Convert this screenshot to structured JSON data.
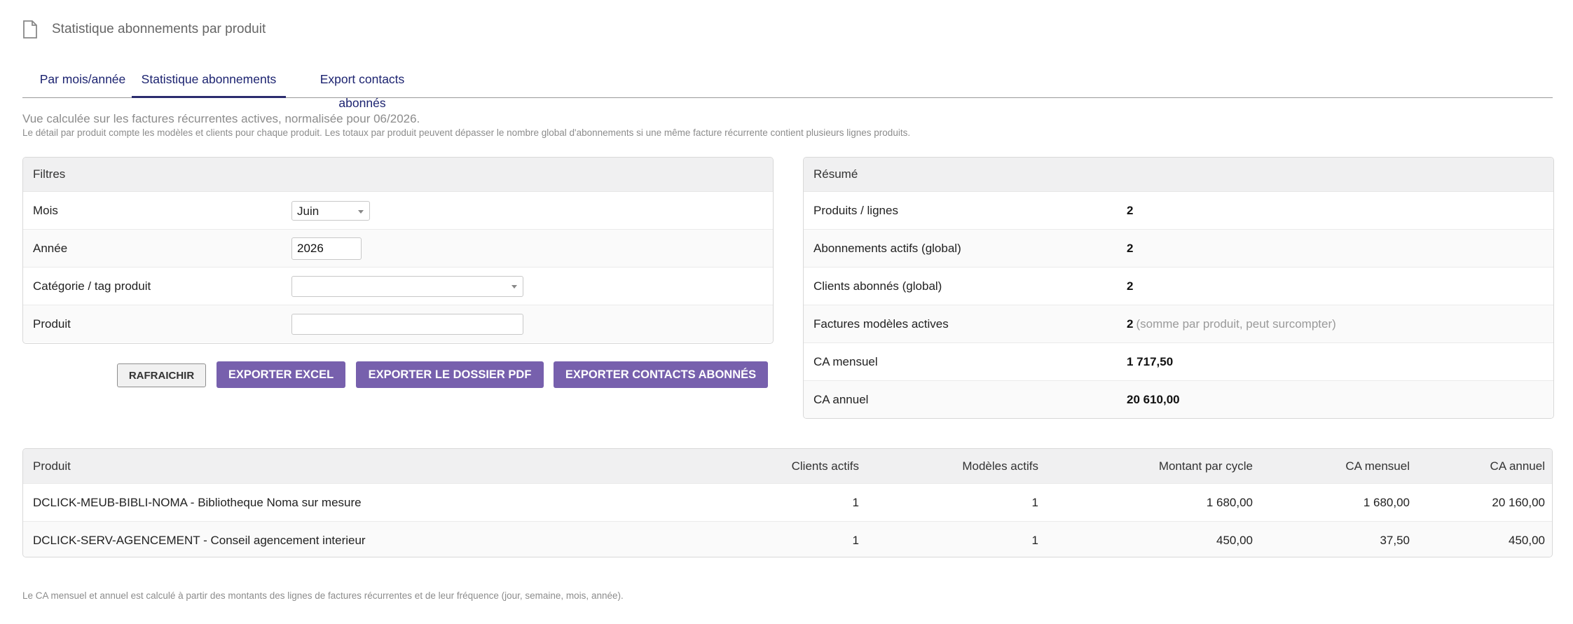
{
  "page": {
    "title": "Statistique abonnements par produit",
    "icon": "document-icon"
  },
  "tabs": [
    {
      "label": "Par mois/année",
      "active": false
    },
    {
      "label": "Statistique abonnements",
      "active": true
    },
    {
      "label": "Export contacts abonnés",
      "active": false
    }
  ],
  "info": {
    "line1": "Vue calculée sur les factures récurrentes actives, normalisée pour 06/2026.",
    "line2": "Le détail par produit compte les modèles et clients pour chaque produit. Les totaux par produit peuvent dépasser le nombre global d'abonnements si une même facture récurrente contient plusieurs lignes produits."
  },
  "filters": {
    "title": "Filtres",
    "month": {
      "label": "Mois",
      "value": "Juin"
    },
    "year": {
      "label": "Année",
      "value": "2026"
    },
    "category": {
      "label": "Catégorie / tag produit",
      "value": ""
    },
    "product": {
      "label": "Produit",
      "value": "",
      "placeholder": ""
    }
  },
  "buttons": {
    "refresh": "RAFRAICHIR",
    "export_excel": "EXPORTER EXCEL",
    "export_pdf": "EXPORTER LE DOSSIER PDF",
    "export_contacts": "EXPORTER CONTACTS ABONNÉS"
  },
  "summary": {
    "title": "Résumé",
    "rows": [
      {
        "label": "Produits / lignes",
        "value": "2",
        "note": ""
      },
      {
        "label": "Abonnements actifs (global)",
        "value": "2",
        "note": ""
      },
      {
        "label": "Clients abonnés (global)",
        "value": "2",
        "note": ""
      },
      {
        "label": "Factures modèles actives",
        "value": "2",
        "note": "(somme par produit, peut surcompter)"
      },
      {
        "label": "CA mensuel",
        "value": "1 717,50",
        "note": ""
      },
      {
        "label": "CA annuel",
        "value": "20 610,00",
        "note": ""
      }
    ]
  },
  "table": {
    "columns": [
      "Produit",
      "Clients actifs",
      "Modèles actifs",
      "Montant par cycle",
      "CA mensuel",
      "CA annuel"
    ],
    "rows": [
      [
        "DCLICK-MEUB-BIBLI-NOMA - Bibliotheque Noma sur mesure",
        "1",
        "1",
        "1 680,00",
        "1 680,00",
        "20 160,00"
      ],
      [
        "DCLICK-SERV-AGENCEMENT - Conseil agencement interieur",
        "1",
        "1",
        "450,00",
        "37,50",
        "450,00"
      ]
    ]
  },
  "footnote": "Le CA mensuel et annuel est calculé à partir des montants des lignes de factures récurrentes et de leur fréquence (jour, semaine, mois, année).",
  "colors": {
    "accent": "#7760ad",
    "tab_text": "#1c2370",
    "header_bg": "#f0f0f1"
  }
}
